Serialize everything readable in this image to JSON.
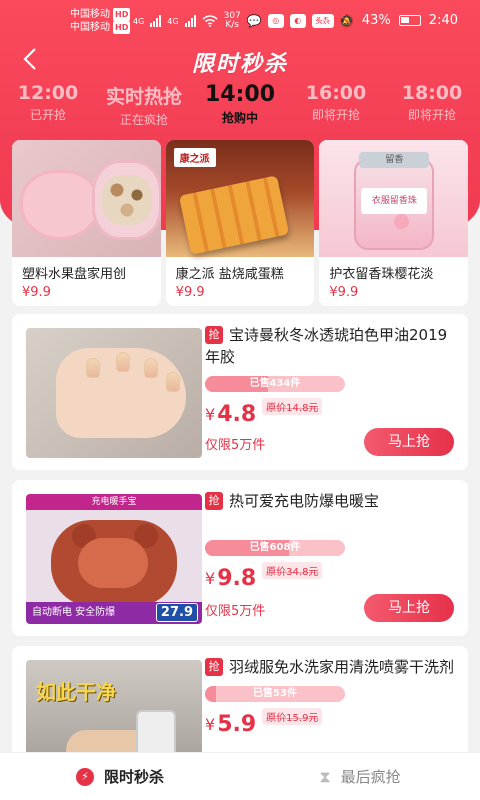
{
  "status": {
    "carrier1": "中国移动",
    "carrier2": "中国移动",
    "hd": "HD",
    "net1": "4G",
    "net2": "4G",
    "speed": "307",
    "speed_unit": "K/s",
    "battery": "43%",
    "time": "2:40",
    "app_badge": "头条"
  },
  "nav": {
    "title": "限时秒杀"
  },
  "slots": [
    {
      "time": "12:00",
      "status": "已开抢"
    },
    {
      "time": "实时热抢",
      "status": "正在疯抢"
    },
    {
      "time": "14:00",
      "status": "抢购中"
    },
    {
      "time": "16:00",
      "status": "即将开抢"
    },
    {
      "time": "18:00",
      "status": "即将开抢"
    }
  ],
  "cards": [
    {
      "name": "塑料水果盘家用创",
      "price": "¥9.9"
    },
    {
      "name": "康之派 盐烧咸蛋糕",
      "price": "¥9.9",
      "logo": "康之派"
    },
    {
      "name": "护衣留香珠樱花淡",
      "price": "¥9.9",
      "jar_brand": "留香",
      "jar_label": "衣服留香珠"
    }
  ],
  "items": [
    {
      "badge": "抢",
      "title": "宝诗曼秋冬冰透琥珀色甲油2019年胶",
      "sold": "已售434件",
      "sold_ratio": 0.45,
      "currency": "¥",
      "price": "4.8",
      "orig": "原价14.8元",
      "limit": "仅限5万件",
      "buy": "马上抢"
    },
    {
      "badge": "抢",
      "title": "热可爱充电防爆电暖宝",
      "sold": "已售608件",
      "sold_ratio": 0.6,
      "currency": "¥",
      "price": "9.8",
      "orig": "原价34.8元",
      "limit": "仅限5万件",
      "buy": "马上抢",
      "img_header": "充电暖手宝",
      "img_footer": "自动断电  安全防爆",
      "img_price": "27.9"
    },
    {
      "badge": "抢",
      "title": "羽绒服免水洗家用清洗喷雾干洗剂",
      "sold": "已售53件",
      "sold_ratio": 0.08,
      "currency": "¥",
      "price": "5.9",
      "orig": "原价15.9元",
      "img_caption": "如此干净"
    }
  ],
  "tabs": [
    {
      "label": "限时秒杀"
    },
    {
      "label": "最后疯抢"
    }
  ],
  "colors": {
    "brand_red": "#e53246",
    "hero": "#f33f55"
  }
}
